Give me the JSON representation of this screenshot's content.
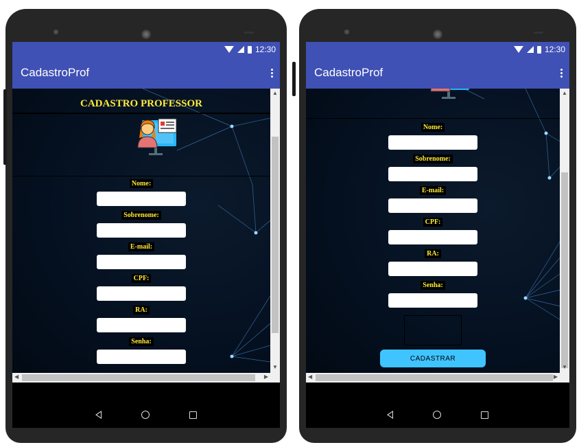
{
  "status_bar": {
    "time": "12:30"
  },
  "app_bar": {
    "title": "CadastroProf"
  },
  "left_screen": {
    "header_title": "CADASTRO PROFESSOR",
    "fields": [
      {
        "label": "Nome:",
        "value": ""
      },
      {
        "label": "Sobrenome:",
        "value": ""
      },
      {
        "label": "E-mail:",
        "value": ""
      },
      {
        "label": "CPF:",
        "value": ""
      },
      {
        "label": "RA:",
        "value": ""
      },
      {
        "label": "Senha:",
        "value": ""
      }
    ]
  },
  "right_screen": {
    "fields": [
      {
        "label": "Nome:",
        "value": ""
      },
      {
        "label": "Sobrenome:",
        "value": ""
      },
      {
        "label": "E-mail:",
        "value": ""
      },
      {
        "label": "CPF:",
        "value": ""
      },
      {
        "label": "RA:",
        "value": ""
      },
      {
        "label": "Senha:",
        "value": ""
      }
    ],
    "submit_label": "CADASTRAR"
  },
  "colors": {
    "app_bar": "#3f51b5",
    "label_text": "#ffeb3b",
    "button": "#40c4ff",
    "background": "#041020"
  },
  "icons": [
    "wifi-icon",
    "signal-icon",
    "battery-icon",
    "overflow-menu-icon",
    "teacher-icon",
    "back-icon",
    "home-icon",
    "recent-apps-icon"
  ]
}
